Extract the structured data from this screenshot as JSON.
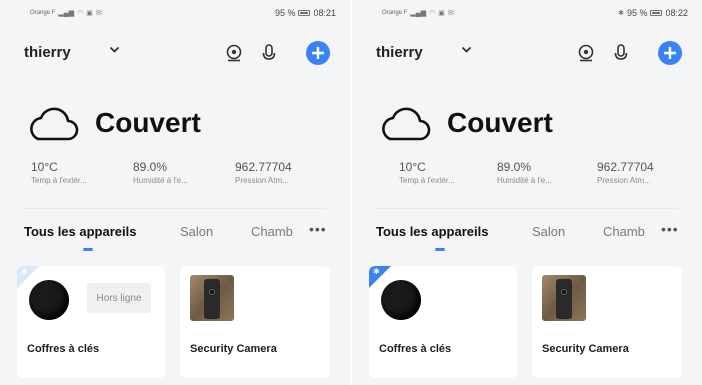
{
  "screens": [
    {
      "status_bar": {
        "carrier": "Orange F",
        "battery": "95 %",
        "time": "08:21"
      },
      "header": {
        "home_name": "thierry"
      },
      "weather": {
        "condition": "Couvert"
      },
      "stats": [
        {
          "value": "10°C",
          "label": "Temp à l'extér..."
        },
        {
          "value": "89.0%",
          "label": "Humidité à l'e..."
        },
        {
          "value": "962.77704",
          "label": "Pression Atm..."
        }
      ],
      "tabs": [
        {
          "label": "Tous les appareils"
        },
        {
          "label": "Salon"
        },
        {
          "label": "Chamb"
        }
      ],
      "devices": [
        {
          "name": "Coffres à clés",
          "status": "Hors ligne"
        },
        {
          "name": "Security Camera"
        }
      ]
    },
    {
      "status_bar": {
        "carrier": "Orange F",
        "battery": "95 %",
        "time": "08:22"
      },
      "header": {
        "home_name": "thierry"
      },
      "weather": {
        "condition": "Couvert"
      },
      "stats": [
        {
          "value": "10°C",
          "label": "Temp à l'extér..."
        },
        {
          "value": "89.0%",
          "label": "Humidité à l'e..."
        },
        {
          "value": "962.77704",
          "label": "Pression Atm..."
        }
      ],
      "tabs": [
        {
          "label": "Tous les appareils"
        },
        {
          "label": "Salon"
        },
        {
          "label": "Chamb"
        }
      ],
      "devices": [
        {
          "name": "Coffres à clés"
        },
        {
          "name": "Security Camera"
        }
      ]
    }
  ],
  "colors": {
    "accent": "#3a82f7",
    "background": "#f4f5f7",
    "card": "#ffffff"
  },
  "icons": [
    "camera-icon",
    "microphone-icon",
    "add-icon",
    "cloud-icon",
    "chevron-down-icon",
    "more-icon",
    "bluetooth-icon"
  ]
}
